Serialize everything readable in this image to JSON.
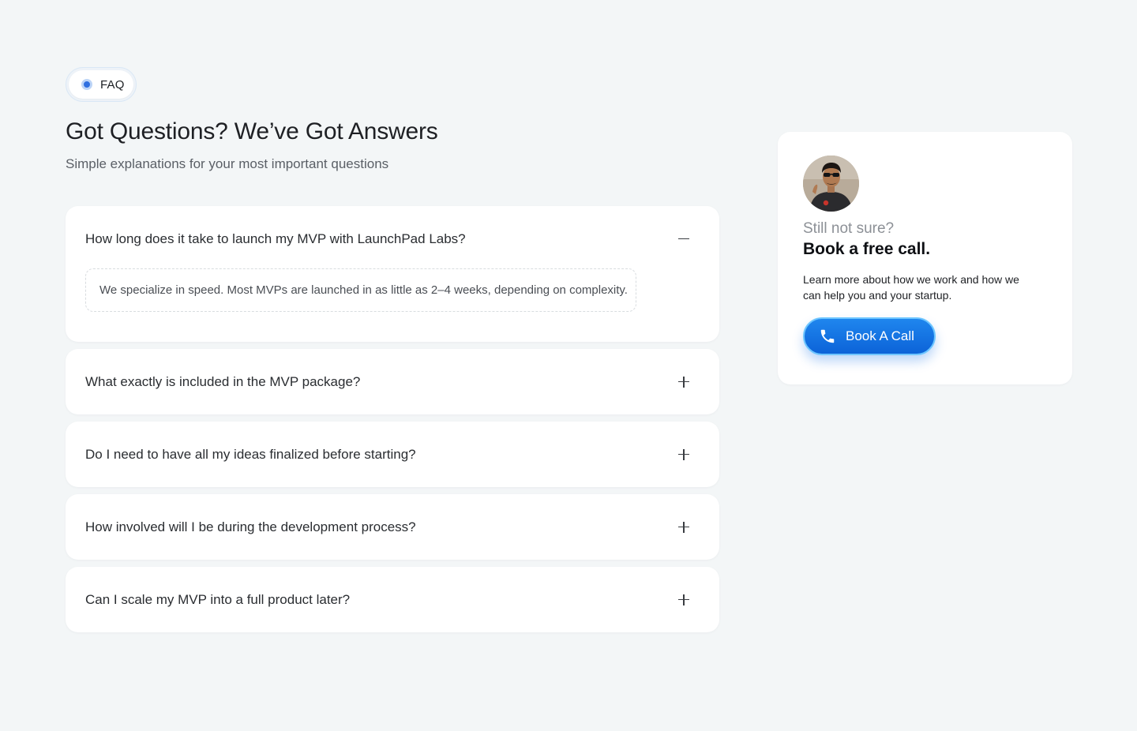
{
  "section": {
    "badge": "FAQ",
    "title": "Got Questions? We’ve Got Answers",
    "subtitle": "Simple explanations for your most important questions"
  },
  "faq": [
    {
      "question": "How long does it take to launch my MVP with LaunchPad Labs?",
      "answer": "We specialize in speed. Most MVPs are launched in as little as 2–4 weeks, depending on complexity.",
      "expanded": true,
      "toggle_icon": "minus-icon"
    },
    {
      "question": "What exactly is included in the MVP package?",
      "expanded": false,
      "toggle_icon": "plus-icon"
    },
    {
      "question": "Do I need to have all my ideas finalized before starting?",
      "expanded": false,
      "toggle_icon": "plus-icon"
    },
    {
      "question": "How involved will I be during the development process?",
      "expanded": false,
      "toggle_icon": "plus-icon"
    },
    {
      "question": "Can I scale my MVP into a full product later?",
      "expanded": false,
      "toggle_icon": "plus-icon"
    }
  ],
  "cta_card": {
    "kicker": "Still not sure?",
    "title": "Book a free call.",
    "text": "Learn more about how we work and how we can help you and your startup.",
    "button_label": "Book A Call",
    "button_icon": "phone-icon"
  },
  "colors": {
    "background": "#f3f6f7",
    "accent": "#1374e4",
    "badge_dot": "#2f6fe0"
  }
}
